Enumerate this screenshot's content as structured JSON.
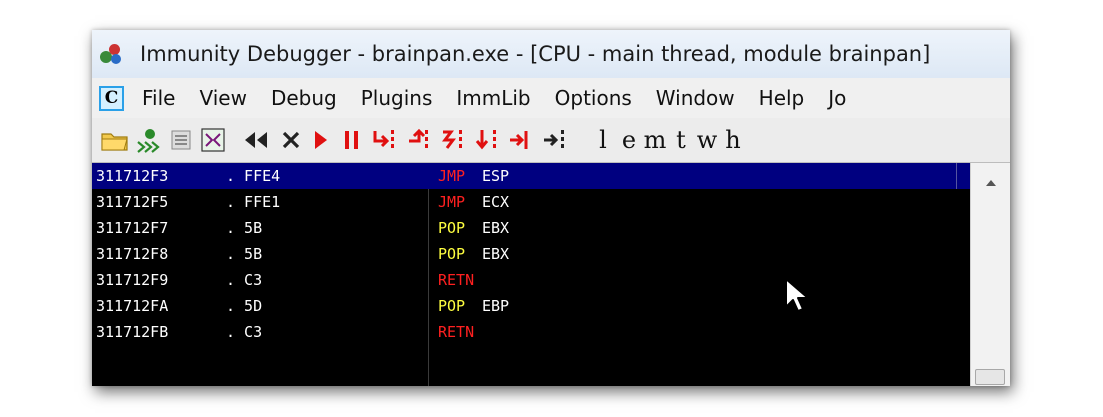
{
  "window": {
    "title": "Immunity Debugger - brainpan.exe - [CPU - main thread, module brainpan]"
  },
  "menu": {
    "cpu_icon_label": "C",
    "items": [
      "File",
      "View",
      "Debug",
      "Plugins",
      "ImmLib",
      "Options",
      "Window",
      "Help",
      "Jo"
    ]
  },
  "toolbar": {
    "letters": [
      "l",
      "e",
      "m",
      "t",
      "w",
      "h"
    ]
  },
  "colors": {
    "jump": "#ff2020",
    "stack": "#ffff40",
    "ret": "#ff2020",
    "selection": "#000080"
  },
  "disassembly": [
    {
      "address": "311712F3",
      "hex": ". FFE4",
      "mnemonic": "JMP",
      "operand": "ESP",
      "kind": "jump",
      "selected": true
    },
    {
      "address": "311712F5",
      "hex": ". FFE1",
      "mnemonic": "JMP",
      "operand": "ECX",
      "kind": "jump",
      "selected": false
    },
    {
      "address": "311712F7",
      "hex": ". 5B",
      "mnemonic": "POP",
      "operand": "EBX",
      "kind": "stack",
      "selected": false
    },
    {
      "address": "311712F8",
      "hex": ". 5B",
      "mnemonic": "POP",
      "operand": "EBX",
      "kind": "stack",
      "selected": false
    },
    {
      "address": "311712F9",
      "hex": ". C3",
      "mnemonic": "RETN",
      "operand": "",
      "kind": "ret",
      "selected": false
    },
    {
      "address": "311712FA",
      "hex": ". 5D",
      "mnemonic": "POP",
      "operand": "EBP",
      "kind": "stack",
      "selected": false
    },
    {
      "address": "311712FB",
      "hex": ". C3",
      "mnemonic": "RETN",
      "operand": "",
      "kind": "ret",
      "selected": false
    }
  ]
}
